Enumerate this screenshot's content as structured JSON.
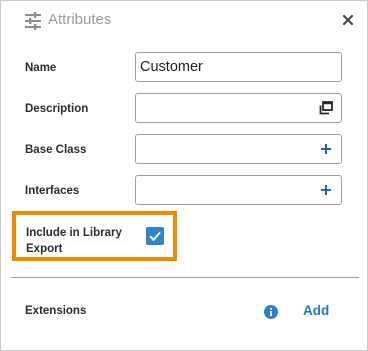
{
  "header": {
    "title": "Attributes",
    "title_icon": "tune-sliders-icon",
    "close_icon": "close-icon"
  },
  "fields": {
    "name": {
      "label": "Name",
      "value": "Customer"
    },
    "description": {
      "label": "Description",
      "value": "",
      "button_icon": "expand-window-icon"
    },
    "base_class": {
      "label": "Base Class",
      "value": "",
      "button_icon": "plus-icon"
    },
    "interfaces": {
      "label": "Interfaces",
      "value": "",
      "button_icon": "plus-icon"
    }
  },
  "library_export": {
    "label": "Include in Library Export",
    "checked": true,
    "highlight_color": "#f08a00"
  },
  "extensions": {
    "label": "Extensions",
    "info_icon": "info-icon",
    "add_label": "Add"
  },
  "colors": {
    "accent": "#2f84c6",
    "link": "#1e78c2"
  }
}
